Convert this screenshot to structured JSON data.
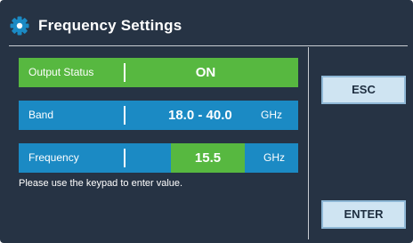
{
  "header": {
    "title": "Frequency Settings",
    "icon": "gear-icon"
  },
  "settings": {
    "output_status": {
      "label": "Output Status",
      "value": "ON"
    },
    "band": {
      "label": "Band",
      "value": "18.0 - 40.0",
      "unit": "GHz"
    },
    "frequency": {
      "label": "Frequency",
      "value": "15.5",
      "unit": "GHz"
    }
  },
  "hint": "Please use the keypad to enter value.",
  "buttons": {
    "esc_label": "ESC",
    "enter_label": "ENTER"
  },
  "colors": {
    "background": "#263344",
    "status_green": "#57b840",
    "row_blue": "#1b8ac4",
    "button_fill": "#cfe4f2"
  }
}
